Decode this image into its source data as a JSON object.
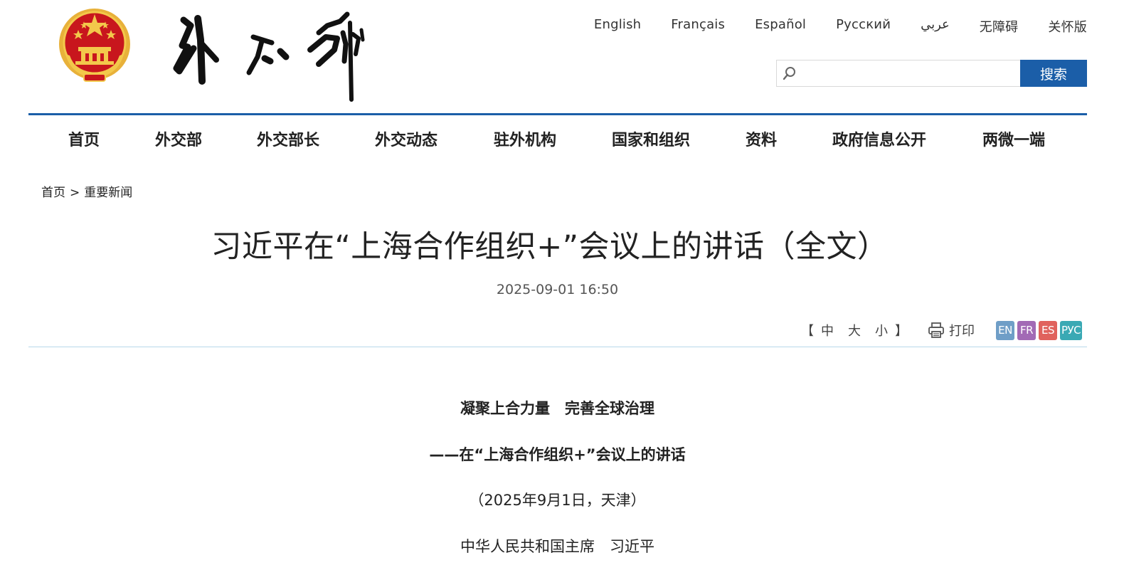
{
  "header": {
    "languages": [
      "English",
      "Français",
      "Español",
      "Русский",
      "عربي",
      "无障碍",
      "关怀版"
    ],
    "search": {
      "placeholder": "",
      "button_label": "搜索"
    }
  },
  "nav": {
    "items": [
      "首页",
      "外交部",
      "外交部长",
      "外交动态",
      "驻外机构",
      "国家和组织",
      "资料",
      "政府信息公开",
      "两微一端"
    ]
  },
  "breadcrumb": {
    "home": "首页",
    "separator": ">",
    "current": "重要新闻"
  },
  "article": {
    "title": "习近平在“上海合作组织+”会议上的讲话（全文）",
    "date": "2025-09-01 16:50",
    "headline": "凝聚上合力量　完善全球治理",
    "subtitle": "——在“上海合作组织+”会议上的讲话",
    "place_date": "（2025年9月1日，天津）",
    "speaker": "中华人民共和国主席　习近平"
  },
  "tools": {
    "font_open": "【",
    "font_sizes": [
      "中",
      "大",
      "小"
    ],
    "font_close": "】",
    "print_label": "打印",
    "language_badges": [
      {
        "label": "EN",
        "color": "#6f9ec7"
      },
      {
        "label": "FR",
        "color": "#a26ab5"
      },
      {
        "label": "ES",
        "color": "#e0625d"
      },
      {
        "label": "РУС",
        "color": "#3aa9b4"
      }
    ]
  },
  "colors": {
    "brand_blue": "#1b5ea8",
    "divider": "#b8d7ea"
  }
}
